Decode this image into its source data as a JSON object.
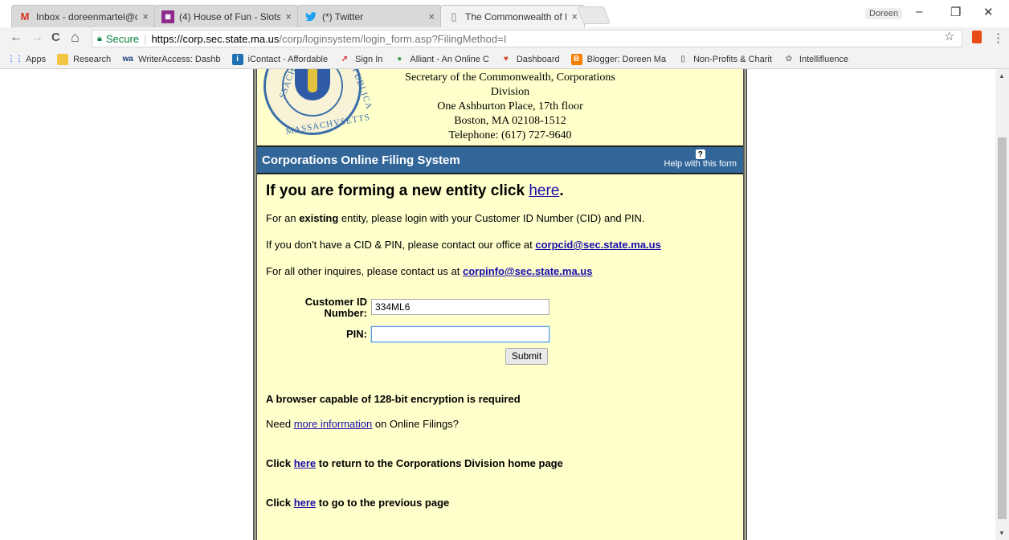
{
  "browser": {
    "tabs": [
      {
        "favicon": "gmail-icon",
        "label": "Inbox - doreenmartel@d",
        "close": "×"
      },
      {
        "favicon": "slots-icon",
        "label": "(4) House of Fun - Slots c",
        "close": "×"
      },
      {
        "favicon": "twitter-icon",
        "label": "(*) Twitter",
        "close": "×"
      },
      {
        "favicon": "page-icon",
        "label": "The Commonwealth of M",
        "close": "×"
      }
    ],
    "profile": "Doreen",
    "window_controls": {
      "minimize": "–",
      "restore": "❐",
      "close": "✕"
    },
    "nav": {
      "back": "←",
      "forward": "→",
      "reload": "C",
      "home": "⌂"
    },
    "omnibox": {
      "secure": "Secure",
      "url_host": "https://corp.sec.state.ma.us",
      "url_path": "/corp/loginsystem/login_form.asp?FilingMethod=I"
    },
    "bookmark_star": "☆",
    "menu": "⋮",
    "bookmarks": [
      {
        "icon": "apps-icon",
        "label": "Apps",
        "color": "#4285f4"
      },
      {
        "icon": "folder-icon",
        "label": "Research",
        "color": "#f4c542"
      },
      {
        "icon": "writeraccess-icon",
        "label": "WriterAccess: Dashb",
        "color": "#1b3e7a"
      },
      {
        "icon": "icontact-icon",
        "label": "iContact - Affordable",
        "color": "#1f6fb5"
      },
      {
        "icon": "signin-icon",
        "label": "Sign In",
        "color": "#e02b2b"
      },
      {
        "icon": "alliant-icon",
        "label": "Alliant - An Online C",
        "color": "#3a9b48"
      },
      {
        "icon": "dashboard-icon",
        "label": "Dashboard",
        "color": "#d6472a"
      },
      {
        "icon": "blogger-icon",
        "label": "Blogger: Doreen Ma",
        "color": "#f57d00"
      },
      {
        "icon": "page-icon",
        "label": "Non-Profits & Charit",
        "color": "#888888"
      },
      {
        "icon": "intellifluence-icon",
        "label": "Intellifluence",
        "color": "#999999"
      }
    ]
  },
  "page": {
    "address_lines": [
      "Secretary of the Commonwealth, Corporations",
      "Division",
      "One Ashburton Place, 17th floor",
      "Boston, MA 02108-1512",
      "Telephone: (617) 727-9640"
    ],
    "seal_text_left": "SSACHU",
    "seal_text_right": "REPUBLICA",
    "seal_text_bottom": "MASSACHVSETTS",
    "bar_title": "Corporations Online Filing System",
    "help_icon": "?",
    "help_label": "Help with this form",
    "headline": {
      "prefix": "If you are forming a new entity click ",
      "link": "here",
      "suffix": "."
    },
    "line_existing": {
      "prefix": "For an ",
      "bold": "existing",
      "suffix": " entity, please login with your Customer ID Number (CID) and PIN."
    },
    "line_cid": {
      "prefix": "If you don't have a CID & PIN, please contact our office at ",
      "email": "corpcid@sec.state.ma.us"
    },
    "line_other": {
      "prefix": "For all other inquires, please contact us at ",
      "email": "corpinfo@sec.state.ma.us"
    },
    "form": {
      "cid_label_1": "Customer ID",
      "cid_label_2": "Number:",
      "cid_value": "334ML6",
      "pin_label": "PIN:",
      "pin_value": "",
      "submit_label": "Submit"
    },
    "encryption_note": "A browser capable of 128-bit encryption is required",
    "more_info": {
      "prefix": "Need ",
      "link": "more information",
      "suffix": " on Online Filings?"
    },
    "return_home": {
      "prefix": "Click ",
      "link": "here",
      "suffix": " to return to the Corporations Division home page"
    },
    "previous": {
      "prefix": "Click ",
      "link": "here",
      "suffix": " to go to the previous page"
    }
  }
}
